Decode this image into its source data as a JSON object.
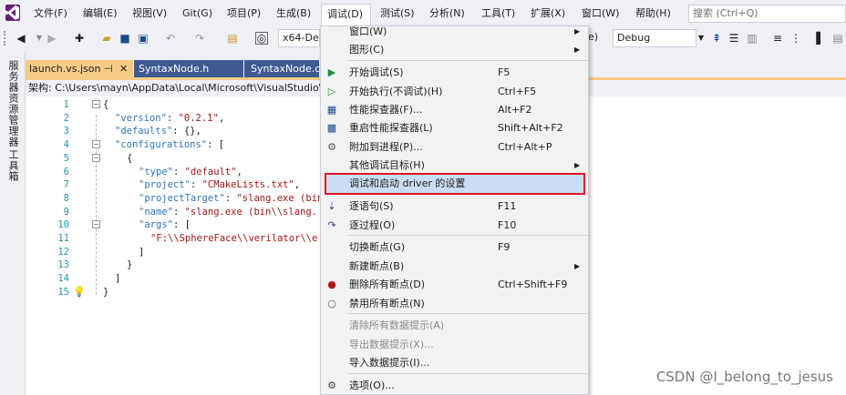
{
  "menubar": {
    "items": [
      "文件(F)",
      "编辑(E)",
      "视图(V)",
      "Git(G)",
      "项目(P)",
      "生成(B)",
      "调试(D)",
      "测试(S)",
      "分析(N)",
      "工具(T)",
      "扩展(X)",
      "窗口(W)",
      "帮助(H)"
    ],
    "search_placeholder": "搜索 (Ctrl+Q)"
  },
  "toolbar": {
    "platform": "x64-Deb",
    "config_tail": "e)",
    "config": "Debug"
  },
  "sidebar": {
    "tab1": "服务器资源管理器",
    "tab2": "工具箱"
  },
  "tabs": [
    {
      "label": "launch.vs.json",
      "pin": "⊣",
      "close": "✕"
    },
    {
      "label": "SyntaxNode.h"
    },
    {
      "label": "SyntaxNode.cpp"
    }
  ],
  "pathbar": {
    "label": "架构:",
    "path": "C:\\Users\\mayn\\AppData\\Local\\Microsoft\\VisualStudio\\"
  },
  "editor": {
    "line_numbers": [
      "1",
      "2",
      "3",
      "4",
      "5",
      "6",
      "7",
      "8",
      "9",
      "10",
      "11",
      "12",
      "13",
      "14",
      "15"
    ],
    "lines": [
      {
        "p": "{"
      },
      {
        "k": "\"version\"",
        "p": ": ",
        "s": "\"0.2.1\"",
        "t": ","
      },
      {
        "k": "\"defaults\"",
        "p": ": {},"
      },
      {
        "k": "\"configurations\"",
        "p": ": ["
      },
      {
        "p": "{"
      },
      {
        "k": "\"type\"",
        "p": ": ",
        "s": "\"default\"",
        "t": ","
      },
      {
        "k": "\"project\"",
        "p": ": ",
        "s": "\"CMakeLists.txt\"",
        "t": ","
      },
      {
        "k": "\"projectTarget\"",
        "p": ": ",
        "s": "\"slang.exe (bin"
      },
      {
        "k": "\"name\"",
        "p": ": ",
        "s": "\"slang.exe (bin\\\\slang."
      },
      {
        "k": "\"args\"",
        "p": ": ["
      },
      {
        "s": "\"F:\\\\SphereFace\\\\verilator\\\\e"
      },
      {
        "p": "]"
      },
      {
        "p": "}"
      },
      {
        "p": "]"
      },
      {
        "p": "}"
      }
    ]
  },
  "debug_menu": {
    "items": [
      {
        "label": "窗口(W)",
        "shortcut": "",
        "submenu": true,
        "icon": ""
      },
      {
        "label": "图形(C)",
        "shortcut": "",
        "submenu": true,
        "icon": ""
      },
      {
        "label": "开始调试(S)",
        "shortcut": "F5",
        "icon": "play-icon"
      },
      {
        "label": "开始执行(不调试)(H)",
        "shortcut": "Ctrl+F5",
        "icon": "play-outline-icon"
      },
      {
        "label": "性能探查器(F)...",
        "shortcut": "Alt+F2",
        "icon": "profiler-icon"
      },
      {
        "label": "重启性能探查器(L)",
        "shortcut": "Shift+Alt+F2",
        "icon": "profiler-restart-icon"
      },
      {
        "label": "附加到进程(P)...",
        "shortcut": "Ctrl+Alt+P",
        "icon": "gears-icon"
      },
      {
        "label": "其他调试目标(H)",
        "shortcut": "",
        "submenu": true,
        "icon": ""
      },
      {
        "label": "调试和启动 driver 的设置",
        "shortcut": "",
        "icon": ""
      },
      {
        "label": "逐语句(S)",
        "shortcut": "F11",
        "icon": "step-into-icon"
      },
      {
        "label": "逐过程(O)",
        "shortcut": "F10",
        "icon": "step-over-icon"
      },
      {
        "label": "切换断点(G)",
        "shortcut": "F9",
        "icon": ""
      },
      {
        "label": "新建断点(B)",
        "shortcut": "",
        "submenu": true,
        "icon": ""
      },
      {
        "label": "删除所有断点(D)",
        "shortcut": "Ctrl+Shift+F9",
        "icon": "delete-breakpoints-icon"
      },
      {
        "label": "禁用所有断点(N)",
        "shortcut": "",
        "icon": "disable-breakpoints-icon"
      },
      {
        "label": "清除所有数据提示(A)",
        "shortcut": "",
        "disabled": true,
        "icon": ""
      },
      {
        "label": "导出数据提示(X)...",
        "shortcut": "",
        "disabled": true,
        "icon": ""
      },
      {
        "label": "导入数据提示(I)...",
        "shortcut": "",
        "icon": ""
      },
      {
        "label": "选项(O)...",
        "shortcut": "",
        "icon": "gear-icon"
      }
    ]
  },
  "watermark": "CSDN @I_belong_to_jesus",
  "colors": {
    "accent": "#68217a",
    "tab_active": "#f5cc84",
    "tab_inactive": "#3e5a91",
    "highlight_border": "#e0161e",
    "highlight_fill": "#c9def5"
  }
}
